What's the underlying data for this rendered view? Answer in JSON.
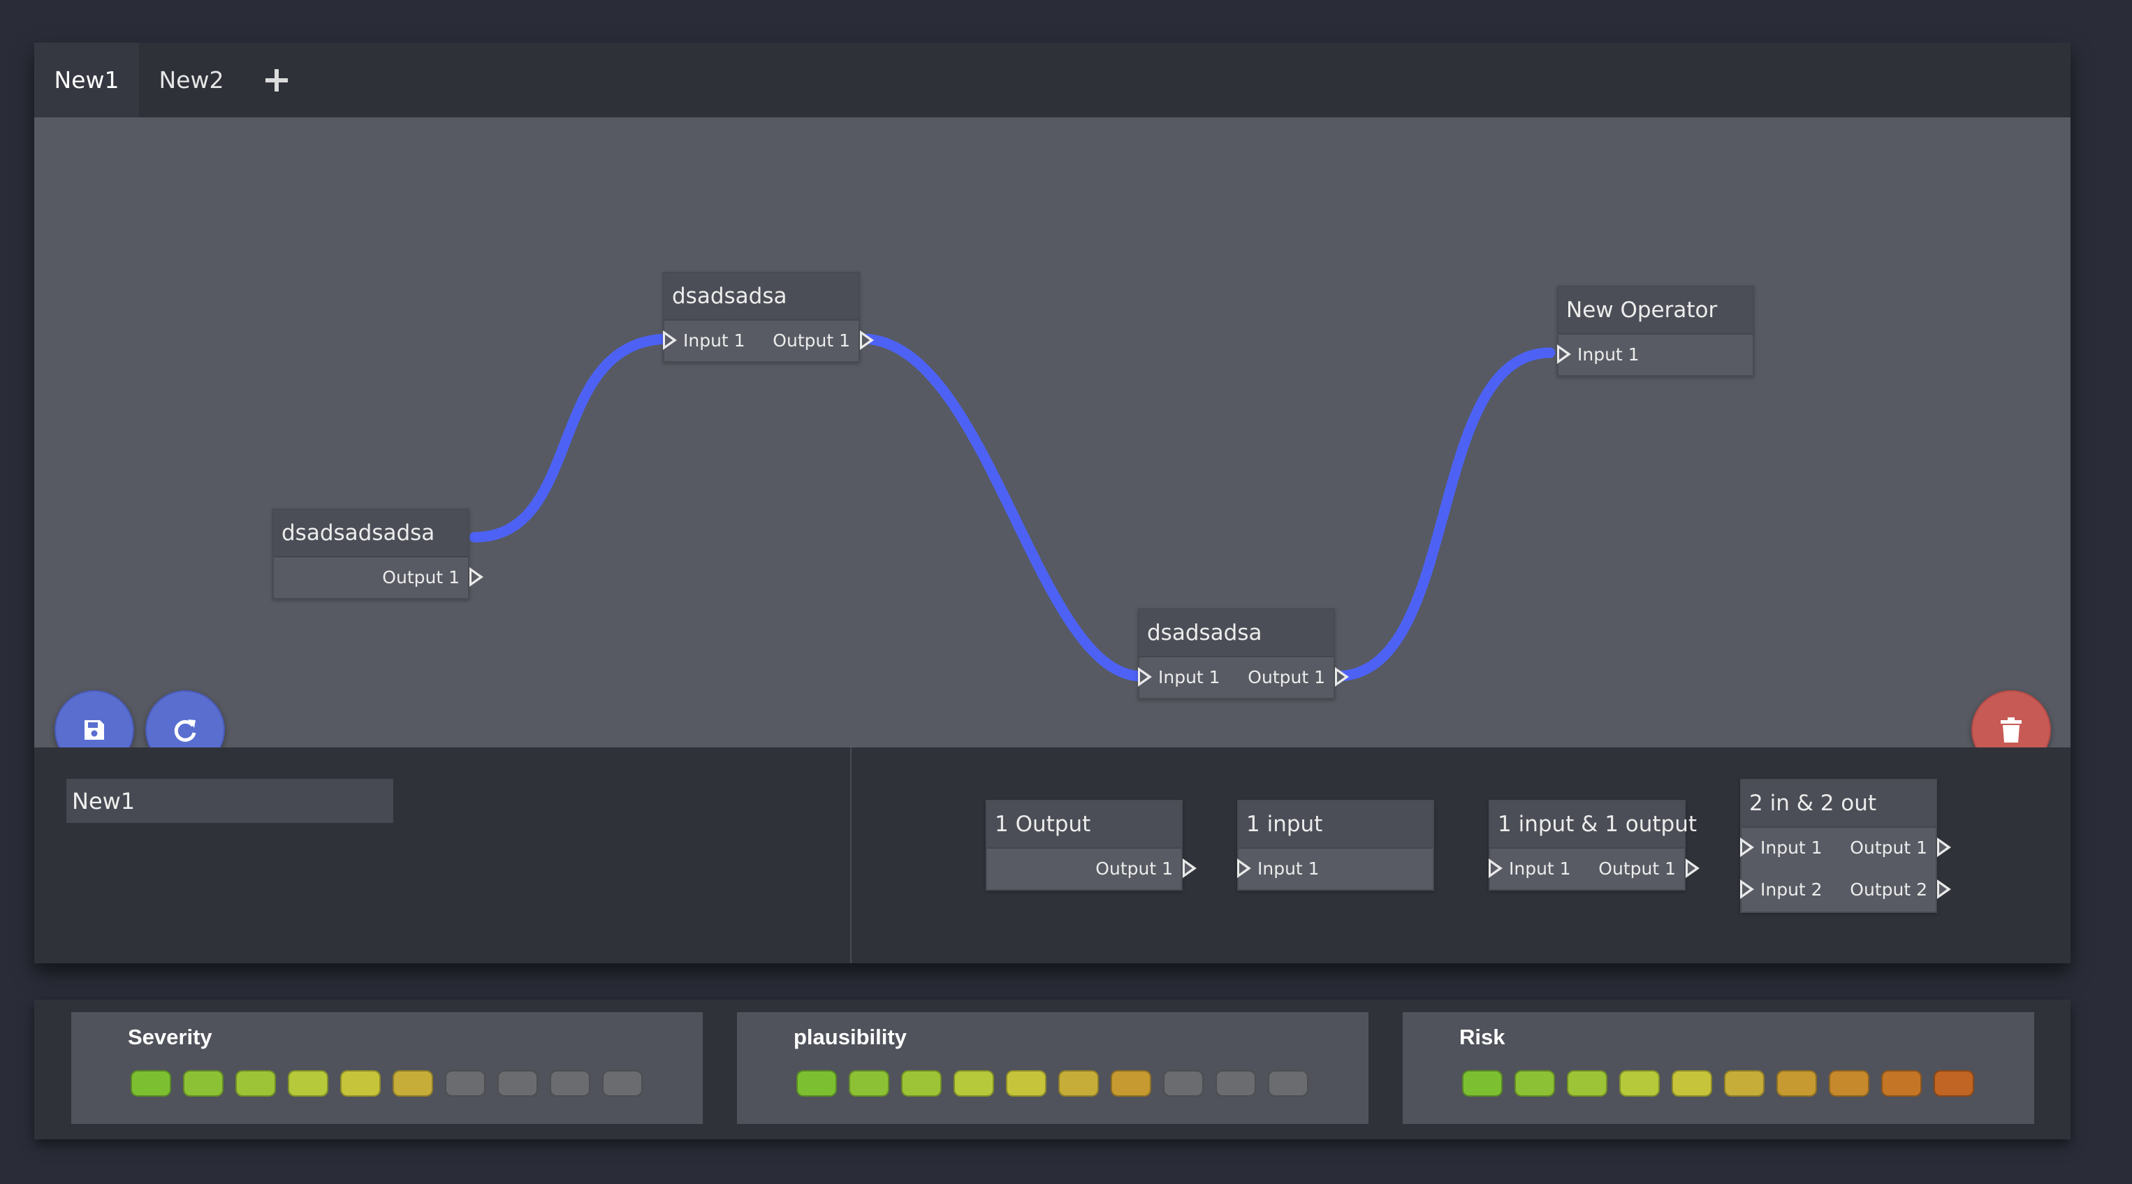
{
  "tabs": [
    {
      "label": "New1",
      "active": true
    },
    {
      "label": "New2",
      "active": false
    }
  ],
  "add_tab_icon": "plus-icon",
  "graph": {
    "nodes": [
      {
        "title": "dsadsadsadsa",
        "outputs": [
          "Output 1"
        ]
      },
      {
        "title": "dsadsadsa",
        "inputs": [
          "Input 1"
        ],
        "outputs": [
          "Output 1"
        ]
      },
      {
        "title": "dsadsadsa",
        "inputs": [
          "Input 1"
        ],
        "outputs": [
          "Output 1"
        ]
      },
      {
        "title": "New Operator",
        "inputs": [
          "Input 1"
        ]
      }
    ],
    "connection_color": "#4d62f5"
  },
  "buttons": {
    "save_icon": "floppy-disk-icon",
    "refresh_icon": "refresh-icon",
    "delete_icon": "trash-icon"
  },
  "editor": {
    "name_value": "New1"
  },
  "palette": [
    {
      "title": "1 Output",
      "outputs": [
        "Output 1"
      ]
    },
    {
      "title": "1 input",
      "inputs": [
        "Input 1"
      ]
    },
    {
      "title": "1 input & 1 output",
      "inputs": [
        "Input 1"
      ],
      "outputs": [
        "Output 1"
      ]
    },
    {
      "title": "2 in & 2 out",
      "inputs": [
        "Input 1",
        "Input 2"
      ],
      "outputs": [
        "Output 1",
        "Output 2"
      ]
    }
  ],
  "metrics": [
    {
      "title": "Severity",
      "colors": [
        "#7cc032",
        "#8cc135",
        "#9dc436",
        "#b5c93a",
        "#c6c43a",
        "#c6ad3a",
        "#6b6c70",
        "#6b6c70",
        "#6b6c70",
        "#6b6c70"
      ]
    },
    {
      "title": "plausibility",
      "colors": [
        "#7cc032",
        "#8cc135",
        "#9dc436",
        "#b5c93a",
        "#c6c43a",
        "#c6ad3a",
        "#c69a30",
        "#6b6c70",
        "#6b6c70",
        "#6b6c70"
      ]
    },
    {
      "title": "Risk",
      "colors": [
        "#7cc032",
        "#8cc135",
        "#9dc436",
        "#b5c93a",
        "#c6c43a",
        "#c6ad3a",
        "#c69a30",
        "#c6892c",
        "#c47626",
        "#c06523"
      ]
    }
  ]
}
